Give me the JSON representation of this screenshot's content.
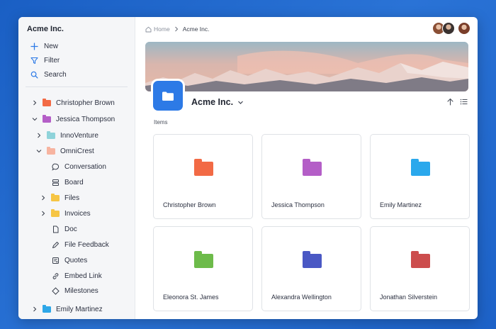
{
  "sidebar": {
    "workspace_name": "Acme Inc.",
    "actions": [
      {
        "label": "New",
        "icon": "plus-icon"
      },
      {
        "label": "Filter",
        "icon": "filter-icon"
      },
      {
        "label": "Search",
        "icon": "search-icon"
      }
    ],
    "tree": [
      {
        "label": "Christopher Brown",
        "kind": "folder",
        "color": "#f26a45",
        "chevron": "right"
      },
      {
        "label": "Jessica Thompson",
        "kind": "folder",
        "color": "#b45ec7",
        "chevron": "down"
      },
      {
        "label": "InnoVenture",
        "kind": "folder",
        "color": "#8fd3da",
        "chevron": "right"
      },
      {
        "label": "OmniCrest",
        "kind": "folder",
        "color": "#f7b4a0",
        "chevron": "down"
      },
      {
        "label": "Conversation",
        "kind": "tool",
        "icon": "chat-bubble-icon"
      },
      {
        "label": "Board",
        "kind": "tool",
        "icon": "board-icon"
      },
      {
        "label": "Files",
        "kind": "folder",
        "color": "#f6c544",
        "chevron": "right"
      },
      {
        "label": "Invoices",
        "kind": "folder",
        "color": "#f6c544",
        "chevron": "right"
      },
      {
        "label": "Doc",
        "kind": "tool",
        "icon": "document-icon"
      },
      {
        "label": "File Feedback",
        "kind": "tool",
        "icon": "pencil-icon"
      },
      {
        "label": "Quotes",
        "kind": "tool",
        "icon": "quotes-icon"
      },
      {
        "label": "Embed Link",
        "kind": "tool",
        "icon": "link-icon"
      },
      {
        "label": "Milestones",
        "kind": "tool",
        "icon": "diamond-icon"
      },
      {
        "label": "Emily Martinez",
        "kind": "folder",
        "color": "#2ea7e8",
        "chevron": "right"
      }
    ]
  },
  "header": {
    "breadcrumb_home": "Home",
    "breadcrumb_current": "Acme Inc."
  },
  "main": {
    "title": "Acme Inc.",
    "section_label": "Items",
    "accent_color": "#2d7ae6",
    "cards": [
      {
        "label": "Christopher Brown",
        "color": "#f26a45"
      },
      {
        "label": "Jessica Thompson",
        "color": "#b45ec7"
      },
      {
        "label": "Emily Martinez",
        "color": "#2aa8ec"
      },
      {
        "label": "Eleonora St. James",
        "color": "#6dbb4a"
      },
      {
        "label": "Alexandra Wellington",
        "color": "#4a58c4"
      },
      {
        "label": "Jonathan Silverstein",
        "color": "#cc4d4d"
      }
    ]
  }
}
